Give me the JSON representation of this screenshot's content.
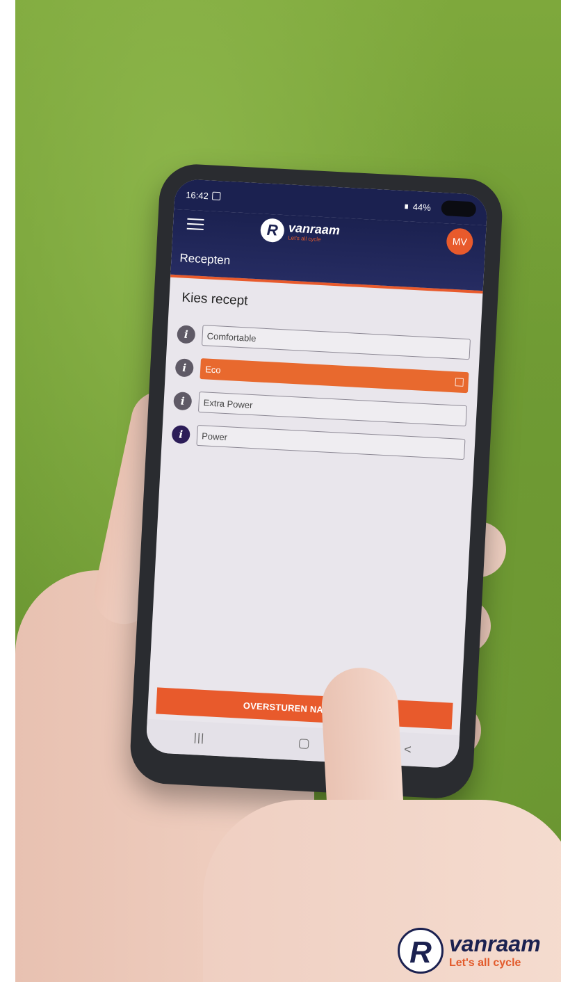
{
  "statusbar": {
    "time": "16:42",
    "signal": "⃛ .∥",
    "battery": "44%"
  },
  "appbar": {
    "brand_name": "vanraam",
    "brand_tagline": "Let's all cycle",
    "avatar_initials": "MV",
    "page_title": "Recepten"
  },
  "content": {
    "section_title": "Kies recept",
    "recipes": [
      {
        "label": "Comfortable",
        "selected": false
      },
      {
        "label": "Eco",
        "selected": true
      },
      {
        "label": "Extra Power",
        "selected": false
      },
      {
        "label": "Power",
        "selected": false
      }
    ]
  },
  "actions": {
    "send_label": "OVERSTUREN NAAR FIETS"
  },
  "navbar": {
    "recent": "|||",
    "back": "<"
  },
  "corner_logo": {
    "name": "vanraam",
    "tagline": "Let's all cycle"
  },
  "colors": {
    "primary": "#1b2150",
    "accent": "#e85a2c"
  }
}
